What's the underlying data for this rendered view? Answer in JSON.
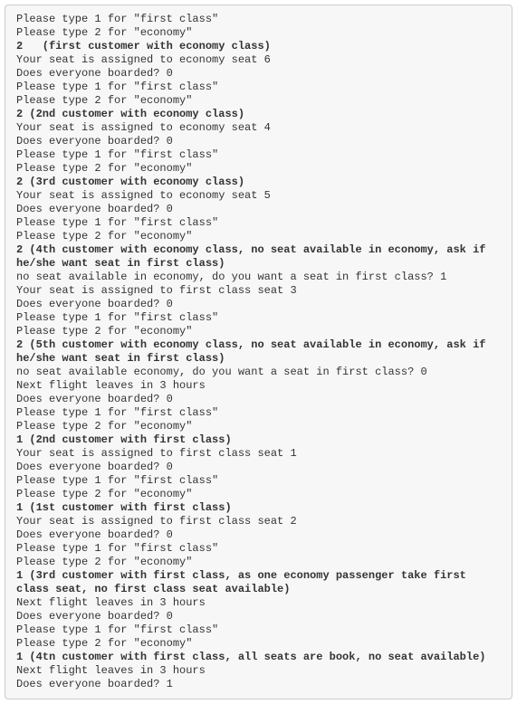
{
  "lines": [
    {
      "text": "Please type 1 for \"first class\"",
      "bold": false
    },
    {
      "text": "Please type 2 for \"economy\"",
      "bold": false
    },
    {
      "text": "2   (first customer with economy class)",
      "bold": true
    },
    {
      "text": "Your seat is assigned to economy seat 6",
      "bold": false
    },
    {
      "text": "Does everyone boarded? 0",
      "bold": false
    },
    {
      "text": "Please type 1 for \"first class\"",
      "bold": false
    },
    {
      "text": "Please type 2 for \"economy\"",
      "bold": false
    },
    {
      "text": "2 (2nd customer with economy class)",
      "bold": true
    },
    {
      "text": "Your seat is assigned to economy seat 4",
      "bold": false
    },
    {
      "text": "Does everyone boarded? 0",
      "bold": false
    },
    {
      "text": "Please type 1 for \"first class\"",
      "bold": false
    },
    {
      "text": "Please type 2 for \"economy\"",
      "bold": false
    },
    {
      "text": "2 (3rd customer with economy class)",
      "bold": true
    },
    {
      "text": "Your seat is assigned to economy seat 5",
      "bold": false
    },
    {
      "text": "Does everyone boarded? 0",
      "bold": false
    },
    {
      "text": "Please type 1 for \"first class\"",
      "bold": false
    },
    {
      "text": "Please type 2 for \"economy\"",
      "bold": false
    },
    {
      "text": "2 (4th customer with economy class, no seat available in economy, ask if he/she want seat in first class)",
      "bold": true
    },
    {
      "text": "no seat available in economy, do you want a seat in first class? 1",
      "bold": false
    },
    {
      "text": "Your seat is assigned to first class seat 3",
      "bold": false
    },
    {
      "text": "Does everyone boarded? 0",
      "bold": false
    },
    {
      "text": "Please type 1 for \"first class\"",
      "bold": false
    },
    {
      "text": "Please type 2 for \"economy\"",
      "bold": false
    },
    {
      "text": "2 (5th customer with economy class, no seat available in economy, ask if he/she want seat in first class)",
      "bold": true
    },
    {
      "text": "no seat available economy, do you want a seat in first class? 0",
      "bold": false
    },
    {
      "text": "Next flight leaves in 3 hours",
      "bold": false
    },
    {
      "text": "Does everyone boarded? 0",
      "bold": false
    },
    {
      "text": "Please type 1 for \"first class\"",
      "bold": false
    },
    {
      "text": "Please type 2 for \"economy\"",
      "bold": false
    },
    {
      "text": "1 (2nd customer with first class)",
      "bold": true
    },
    {
      "text": "Your seat is assigned to first class seat 1",
      "bold": false
    },
    {
      "text": "Does everyone boarded? 0",
      "bold": false
    },
    {
      "text": "Please type 1 for \"first class\"",
      "bold": false
    },
    {
      "text": "Please type 2 for \"economy\"",
      "bold": false
    },
    {
      "text": "1 (1st customer with first class)",
      "bold": true
    },
    {
      "text": "Your seat is assigned to first class seat 2",
      "bold": false
    },
    {
      "text": "Does everyone boarded? 0",
      "bold": false
    },
    {
      "text": "Please type 1 for \"first class\"",
      "bold": false
    },
    {
      "text": "Please type 2 for \"economy\"",
      "bold": false
    },
    {
      "text": "1 (3rd customer with first class, as one economy passenger take first class seat, no first class seat available)",
      "bold": true
    },
    {
      "text": "Next flight leaves in 3 hours",
      "bold": false
    },
    {
      "text": "Does everyone boarded? 0",
      "bold": false
    },
    {
      "text": "Please type 1 for \"first class\"",
      "bold": false
    },
    {
      "text": "Please type 2 for \"economy\"",
      "bold": false
    },
    {
      "text": "1 (4tn customer with first class, all seats are book, no seat available)",
      "bold": true
    },
    {
      "text": "Next flight leaves in 3 hours",
      "bold": false
    },
    {
      "text": "Does everyone boarded? 1",
      "bold": false
    }
  ]
}
